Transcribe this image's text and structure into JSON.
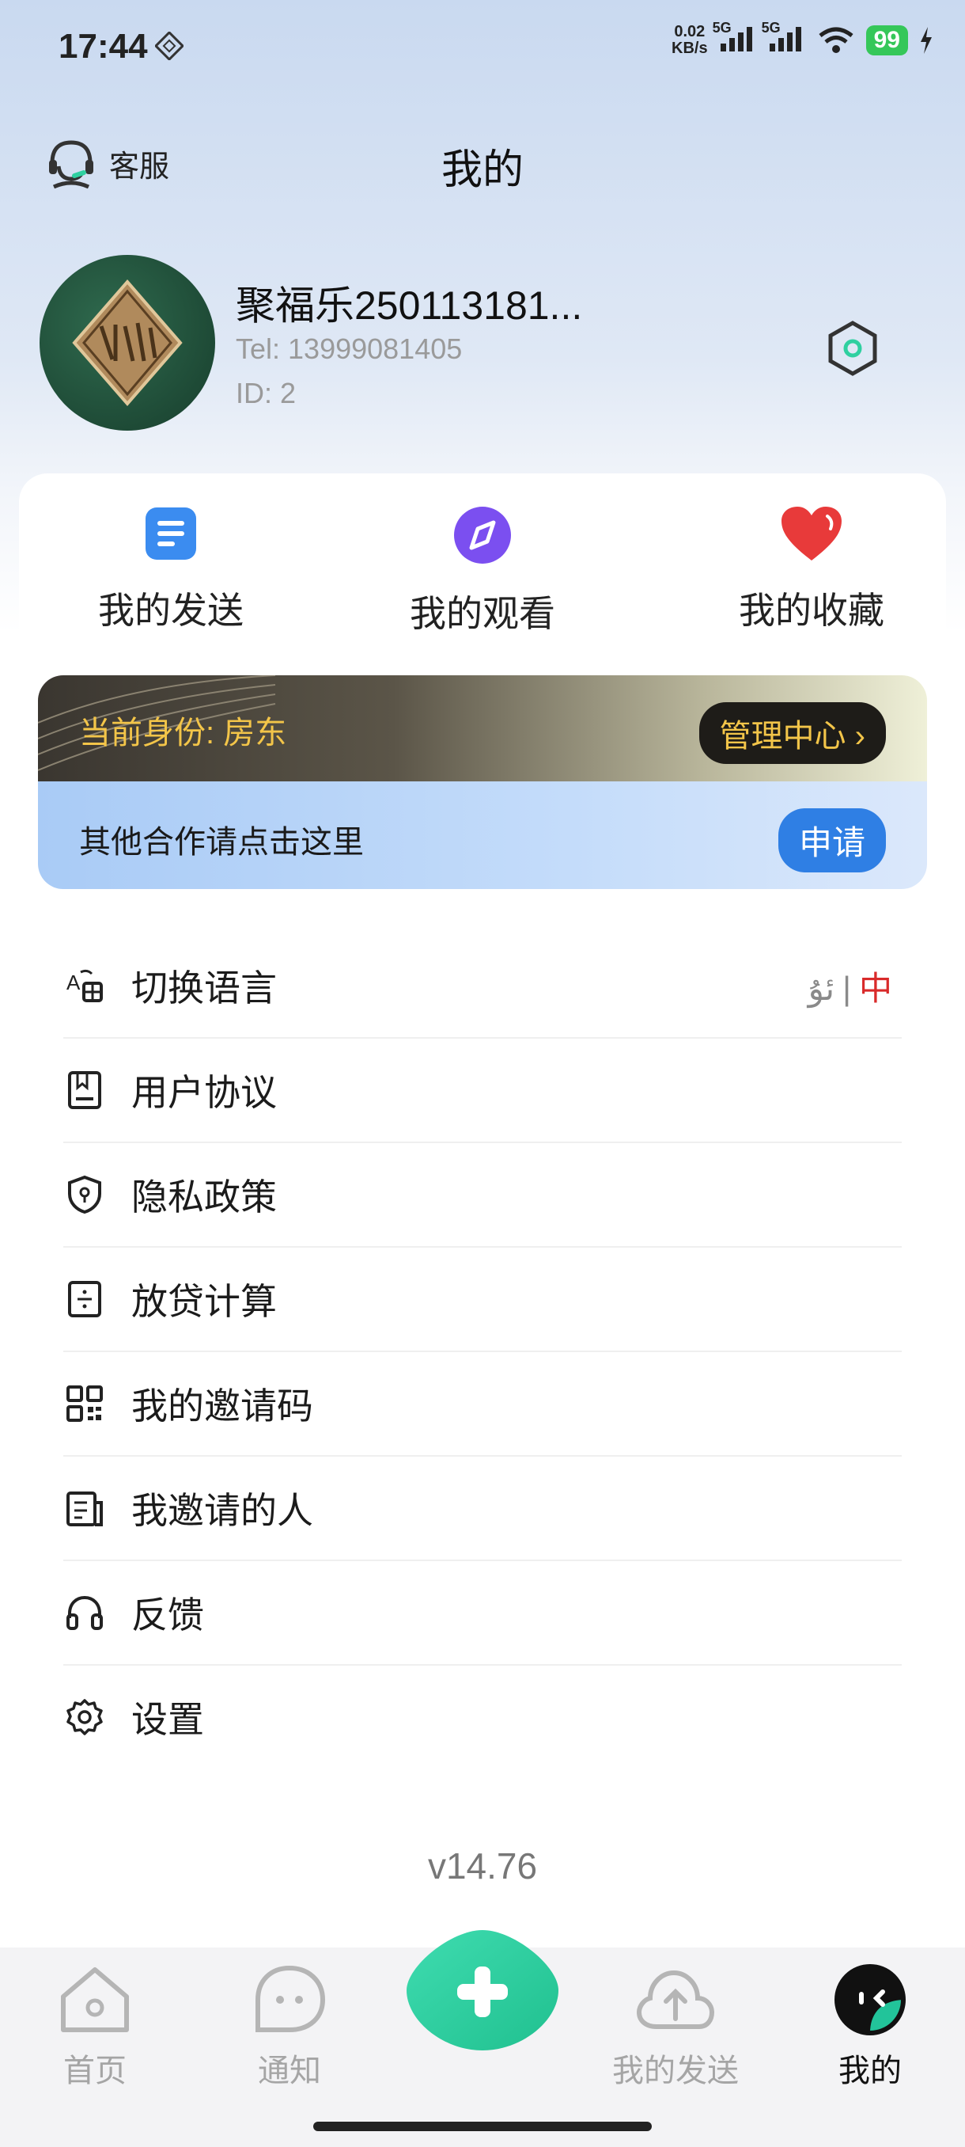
{
  "status_bar": {
    "time": "17:44",
    "net_speed_value": "0.02",
    "net_speed_unit": "KB/s",
    "signal_1": "5G",
    "signal_2": "5G",
    "battery": "99"
  },
  "header": {
    "service_label": "客服",
    "title": "我的"
  },
  "profile": {
    "name": "聚福乐250113181...",
    "tel": "Tel: 13999081405",
    "id": "ID: 2"
  },
  "quick_actions": [
    {
      "label": "我的发送",
      "icon": "document-icon",
      "color": "#3b8cf0"
    },
    {
      "label": "我的观看",
      "icon": "compass-icon",
      "color": "#7b4ff0"
    },
    {
      "label": "我的收藏",
      "icon": "heart-icon",
      "color": "#e83a3a"
    }
  ],
  "role_banner": {
    "current_role": "当前身份: 房东",
    "manage_button": "管理中心",
    "cooperation_text": "其他合作请点击这里",
    "apply_button": "申请"
  },
  "menu": [
    {
      "label": "切换语言",
      "icon": "translate-icon"
    },
    {
      "label": "用户协议",
      "icon": "agreement-icon"
    },
    {
      "label": "隐私政策",
      "icon": "shield-icon"
    },
    {
      "label": "放贷计算",
      "icon": "calculator-icon"
    },
    {
      "label": "我的邀请码",
      "icon": "qr-code-icon"
    },
    {
      "label": "我邀请的人",
      "icon": "invitees-icon"
    },
    {
      "label": "反馈",
      "icon": "headphones-icon"
    },
    {
      "label": "设置",
      "icon": "gear-icon"
    }
  ],
  "language": {
    "ug": "ئۇ",
    "zh": "中"
  },
  "version": "v14.76",
  "bottom_nav": [
    {
      "label": "首页",
      "icon": "home-icon"
    },
    {
      "label": "通知",
      "icon": "chat-icon"
    },
    {
      "label": "我的发送",
      "icon": "upload-cloud-icon"
    },
    {
      "label": "我的",
      "icon": "profile-icon",
      "active": true
    }
  ],
  "colors": {
    "accent_green": "#2fd0a0",
    "apply_blue": "#2f7fe4",
    "role_gold": "#f3c549",
    "language_active": "#d92a2a"
  }
}
